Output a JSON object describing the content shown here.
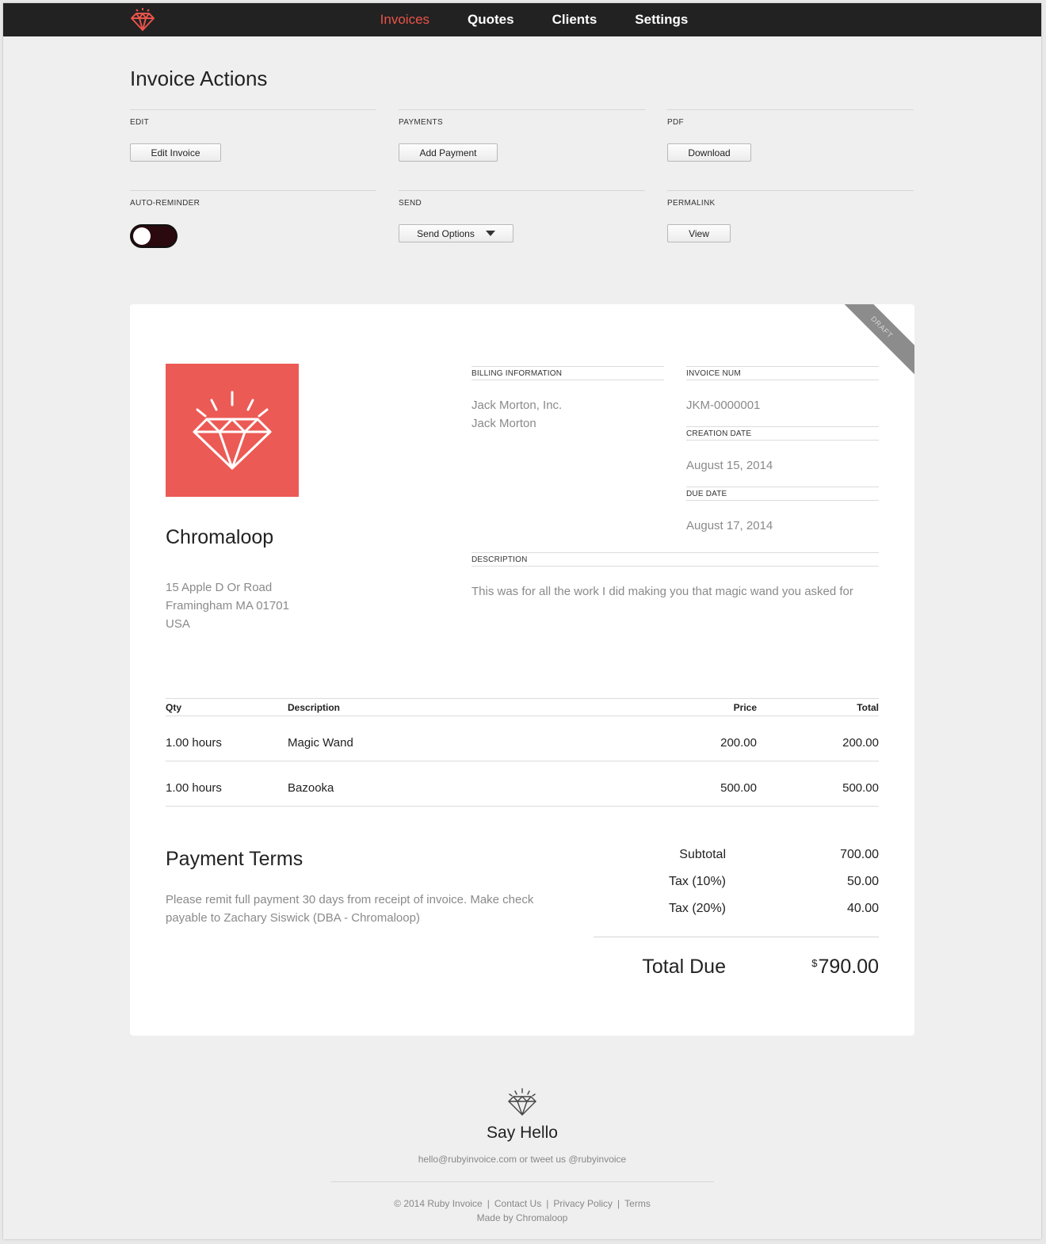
{
  "nav": {
    "items": [
      {
        "label": "Invoices",
        "active": true
      },
      {
        "label": "Quotes",
        "active": false
      },
      {
        "label": "Clients",
        "active": false
      },
      {
        "label": "Settings",
        "active": false
      }
    ],
    "logo_icon": "diamond-icon",
    "accent_color": "#e9534a"
  },
  "actions": {
    "title": "Invoice Actions",
    "edit": {
      "label": "EDIT",
      "button": "Edit Invoice"
    },
    "payments": {
      "label": "PAYMENTS",
      "button": "Add Payment"
    },
    "pdf": {
      "label": "PDF",
      "button": "Download"
    },
    "auto_reminder": {
      "label": "AUTO-REMINDER",
      "enabled": false
    },
    "send": {
      "label": "SEND",
      "button": "Send Options"
    },
    "permalink": {
      "label": "PERMALINK",
      "button": "View"
    }
  },
  "invoice": {
    "ribbon": "DRAFT",
    "company": {
      "name": "Chromaloop",
      "address": [
        "15 Apple D Or Road",
        "Framingham MA 01701",
        "USA"
      ],
      "logo_color": "#ec5a55"
    },
    "billing": {
      "label": "BILLING INFORMATION",
      "lines": [
        "Jack Morton, Inc.",
        "Jack Morton"
      ]
    },
    "invoice_num": {
      "label": "INVOICE NUM",
      "value": "JKM-0000001"
    },
    "creation_date": {
      "label": "CREATION DATE",
      "value": "August 15, 2014"
    },
    "due_date": {
      "label": "DUE DATE",
      "value": "August 17, 2014"
    },
    "description": {
      "label": "DESCRIPTION",
      "value": "This was for all the work I did making you that magic wand you asked for"
    },
    "items_header": {
      "qty": "Qty",
      "description": "Description",
      "price": "Price",
      "total": "Total"
    },
    "items": [
      {
        "qty": "1.00 hours",
        "description": "Magic Wand",
        "price": "200.00",
        "total": "200.00"
      },
      {
        "qty": "1.00 hours",
        "description": "Bazooka",
        "price": "500.00",
        "total": "500.00"
      }
    ],
    "terms": {
      "title": "Payment Terms",
      "text": "Please remit full payment 30 days from receipt of invoice. Make check payable to Zachary Siswick (DBA - Chromaloop)"
    },
    "totals": [
      {
        "label": "Subtotal",
        "value": "700.00"
      },
      {
        "label": "Tax (10%)",
        "value": "50.00"
      },
      {
        "label": "Tax (20%)",
        "value": "40.00"
      }
    ],
    "total_due": {
      "label": "Total Due",
      "currency": "$",
      "value": "790.00"
    }
  },
  "footer": {
    "title": "Say Hello",
    "contact": "hello@rubyinvoice.com or tweet us @rubyinvoice",
    "links": [
      "© 2014 Ruby Invoice",
      "Contact Us",
      "Privacy Policy",
      "Terms"
    ],
    "made_by": "Made by Chromaloop"
  }
}
